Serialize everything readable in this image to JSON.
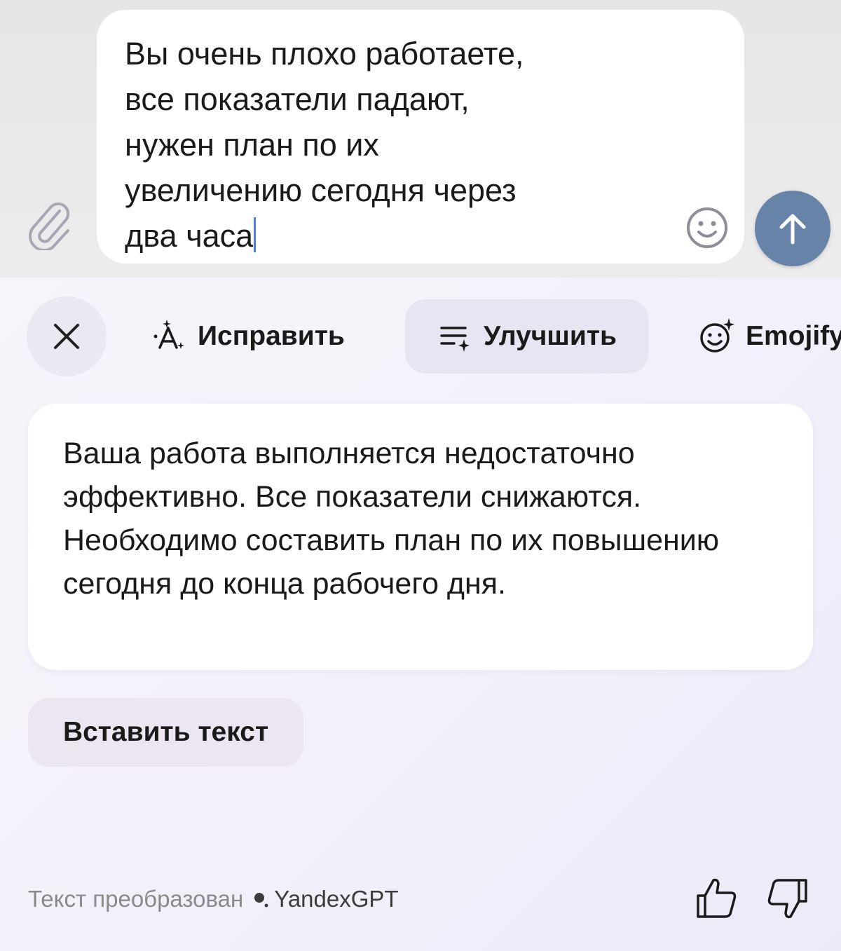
{
  "composer": {
    "message_text": "Вы очень плохо работаете,\nвсе показатели падают,\nнужен план по их\nувеличению сегодня через\nдва часа",
    "icons": {
      "attach": "paperclip-icon",
      "emoji": "smiley-icon",
      "send": "arrow-up-icon"
    },
    "send_button_color": "#6783a8"
  },
  "panel": {
    "close_icon": "close-icon",
    "modes": [
      {
        "label": "Исправить",
        "icon": "fix-text-icon",
        "active": false
      },
      {
        "label": "Улучшить",
        "icon": "improve-text-icon",
        "active": true
      },
      {
        "label": "Emojify",
        "icon": "emojify-icon",
        "active": false
      }
    ],
    "result_text": "Ваша работа выполняется недостаточно эффективно. Все показатели снижаются. Необходимо составить план по их повышению сегодня до конца рабочего дня.",
    "paste_label": "Вставить текст",
    "footer": {
      "credit_prefix": "Текст преобразован",
      "credit_brand": "YandexGPT",
      "like_icon": "thumbs-up-icon",
      "dislike_icon": "thumbs-down-icon"
    }
  }
}
